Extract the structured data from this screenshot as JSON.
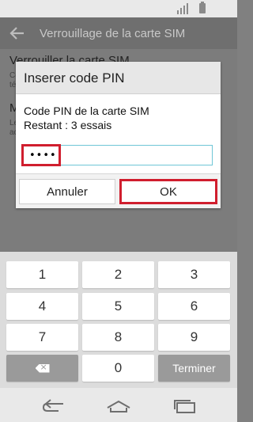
{
  "status_bar": {
    "signal_icon": "signal-icon",
    "battery_icon": "battery-icon"
  },
  "app_bar": {
    "title": "Verrouillage de la carte SIM",
    "back_icon": "back-arrow-icon"
  },
  "background_settings": {
    "item1_title": "Verrouiller la carte SIM",
    "item1_sub1": "Co",
    "item1_sub2": "té",
    "item2_title": "M",
    "item2_sub1": "Le",
    "item2_sub2": "ac"
  },
  "dialog": {
    "title": "Inserer code PIN",
    "message_line1": "Code PIN de la carte SIM",
    "message_line2": "Restant : 3 essais",
    "pin_value": "••••",
    "cancel_label": "Annuler",
    "ok_label": "OK"
  },
  "keyboard": {
    "keys": [
      "1",
      "2",
      "3",
      "4",
      "5",
      "6",
      "7",
      "8",
      "9"
    ],
    "delete_icon": "backspace-icon",
    "zero": "0",
    "done_label": "Terminer"
  },
  "nav_bar": {
    "back_icon": "nav-back-icon",
    "home_icon": "home-icon",
    "recents_icon": "recent-apps-icon"
  },
  "colors": {
    "highlight": "#d01e2e",
    "input_border": "#6fc6d6"
  }
}
